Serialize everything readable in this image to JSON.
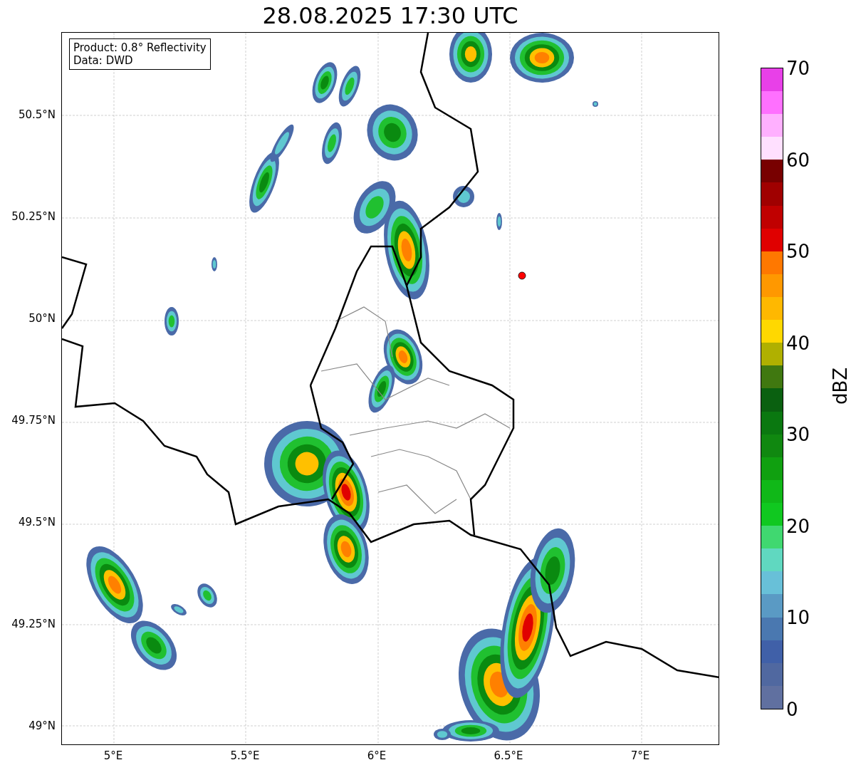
{
  "title": "28.08.2025 17:30 UTC",
  "legend": [
    "Product: 0.8° Reflectivity",
    "Data: DWD"
  ],
  "lat_ticks": [
    "50.5°N",
    "50.25°N",
    "50°N",
    "49.75°N",
    "49.5°N",
    "49.25°N",
    "49°N"
  ],
  "lon_ticks": [
    "5°E",
    "5.5°E",
    "6°E",
    "6.5°E",
    "7°E"
  ],
  "colorbar": {
    "label": "dBZ",
    "ticks": [
      "70",
      "60",
      "50",
      "40",
      "30",
      "20",
      "10",
      "0"
    ]
  }
}
